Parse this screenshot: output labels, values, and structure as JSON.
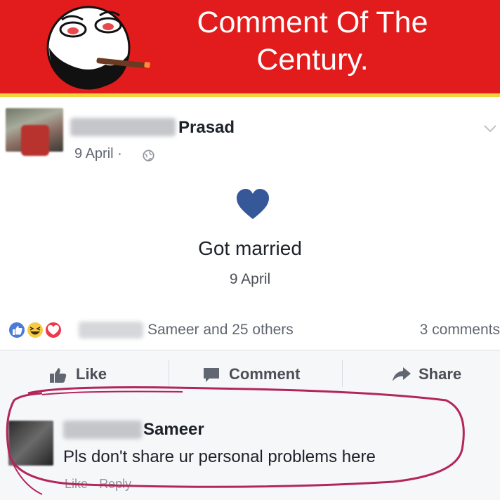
{
  "banner": {
    "title_line1": "Comment Of The",
    "title_line2": "Century.",
    "background_color": "#e21c1c",
    "accent_color": "#f3d23a",
    "mascot_icon": "trollface-mascot-with-cigar"
  },
  "post": {
    "author": "Prasad",
    "date": "9 April",
    "date_separator": "·",
    "privacy_icon": "globe-icon",
    "menu_icon": "chevron-down-icon",
    "event": {
      "icon": "heart-icon",
      "icon_color": "#365899",
      "title": "Got married",
      "date": "9 April"
    },
    "reactions": {
      "icons": [
        "like-reaction-icon",
        "haha-reaction-icon",
        "love-reaction-icon"
      ],
      "summary": "Sameer and 25 others",
      "comment_count": "3 comments"
    },
    "actions": {
      "like": "Like",
      "comment": "Comment",
      "share": "Share"
    }
  },
  "comment": {
    "author": "Sameer",
    "text": "Pls don't share ur personal problems here",
    "like_label": "Like",
    "separator": "·",
    "reply_label": "Reply",
    "highlight_color": "#b3265a"
  }
}
